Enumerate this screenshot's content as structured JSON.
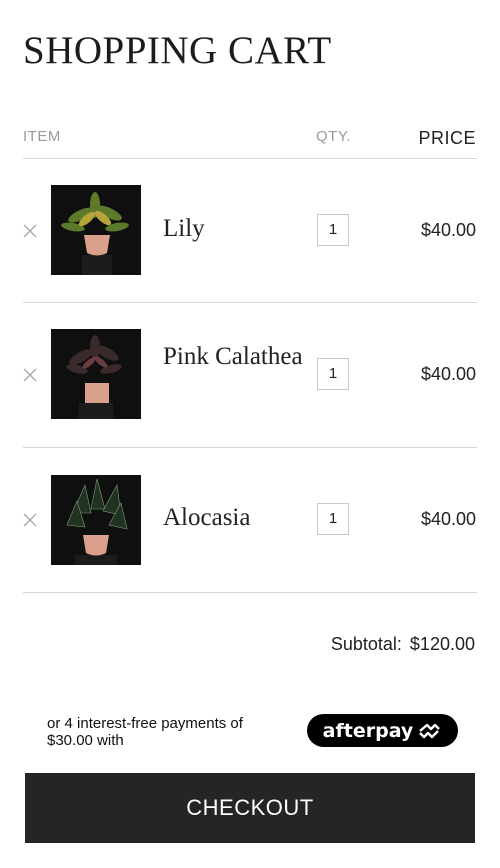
{
  "page": {
    "title": "SHOPPING CART"
  },
  "table": {
    "col_item": "ITEM",
    "col_qty": "QTY.",
    "col_price": "PRICE"
  },
  "items": [
    {
      "name": "Lily",
      "qty": "1",
      "price": "$40.00",
      "image_icon": "lily-plant-image"
    },
    {
      "name": "Pink Calathea",
      "qty": "1",
      "price": "$40.00",
      "image_icon": "pink-calathea-plant-image"
    },
    {
      "name": "Alocasia",
      "qty": "1",
      "price": "$40.00",
      "image_icon": "alocasia-plant-image"
    }
  ],
  "summary": {
    "subtotal_label": "Subtotal:",
    "subtotal_value": "$120.00"
  },
  "afterpay": {
    "text": "or 4 interest-free payments of $30.00 with",
    "brand": "afterpay"
  },
  "checkout": {
    "label": "CHECKOUT"
  },
  "colors": {
    "checkout_bg": "#252525",
    "afterpay_bg": "#000000",
    "pot": "#d9a08c"
  }
}
